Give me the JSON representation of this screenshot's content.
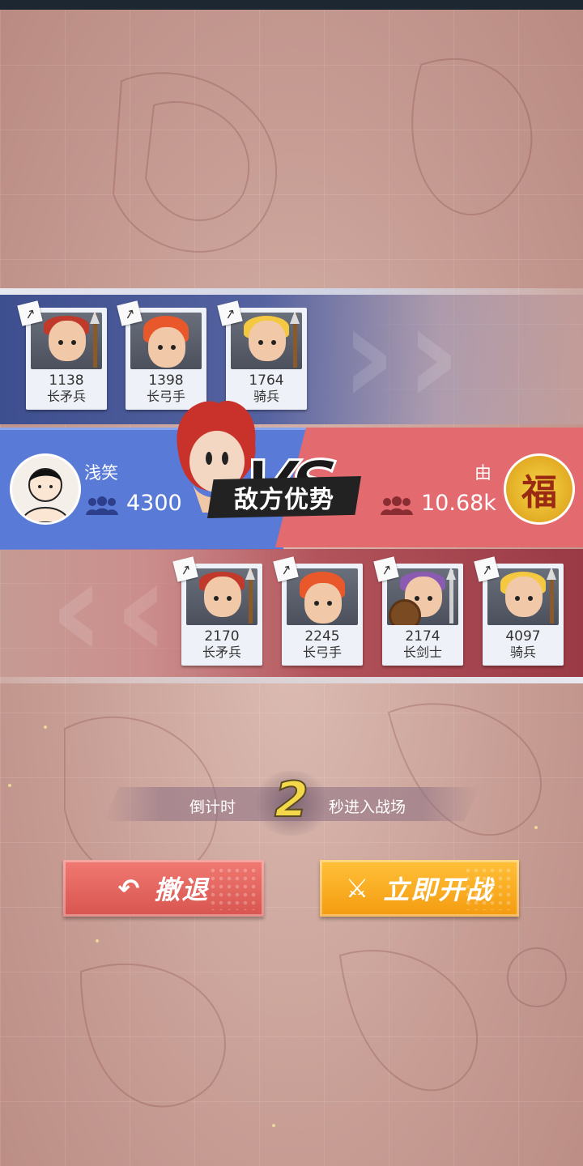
{
  "my_army": {
    "units": [
      {
        "power": "1138",
        "name": "长矛兵",
        "portrait": "spearman-portrait",
        "weapon_tag": "spear-tag-icon"
      },
      {
        "power": "1398",
        "name": "长弓手",
        "portrait": "archer-portrait",
        "weapon_tag": "bow-tag-icon"
      },
      {
        "power": "1764",
        "name": "骑兵",
        "portrait": "cavalry-portrait",
        "weapon_tag": "lance-tag-icon"
      }
    ]
  },
  "player": {
    "name": "浅笑",
    "power": "4300",
    "avatar": "player-avatar"
  },
  "enemy": {
    "name": "由",
    "power": "10.68k",
    "avatar": "fu-character-avatar",
    "avatar_text": "福"
  },
  "advantage_banner": "敌方优势",
  "vs_text": "VS",
  "enemy_army": {
    "units": [
      {
        "power": "2170",
        "name": "长矛兵",
        "portrait": "spearman-portrait"
      },
      {
        "power": "2245",
        "name": "长弓手",
        "portrait": "archer-portrait"
      },
      {
        "power": "2174",
        "name": "长剑士",
        "portrait": "swordsman-portrait"
      },
      {
        "power": "4097",
        "name": "骑兵",
        "portrait": "cavalry-portrait"
      }
    ]
  },
  "countdown": {
    "prefix": "倒计时",
    "seconds": "2",
    "suffix": "秒进入战场"
  },
  "buttons": {
    "retreat": "撤退",
    "fight": "立即开战"
  },
  "colors": {
    "blue_team": "#5a7ad8",
    "red_team": "#e36a6e",
    "retreat_button": "#e0605a",
    "fight_button": "#f7a81f",
    "countdown_digit": "#f3d94a"
  }
}
